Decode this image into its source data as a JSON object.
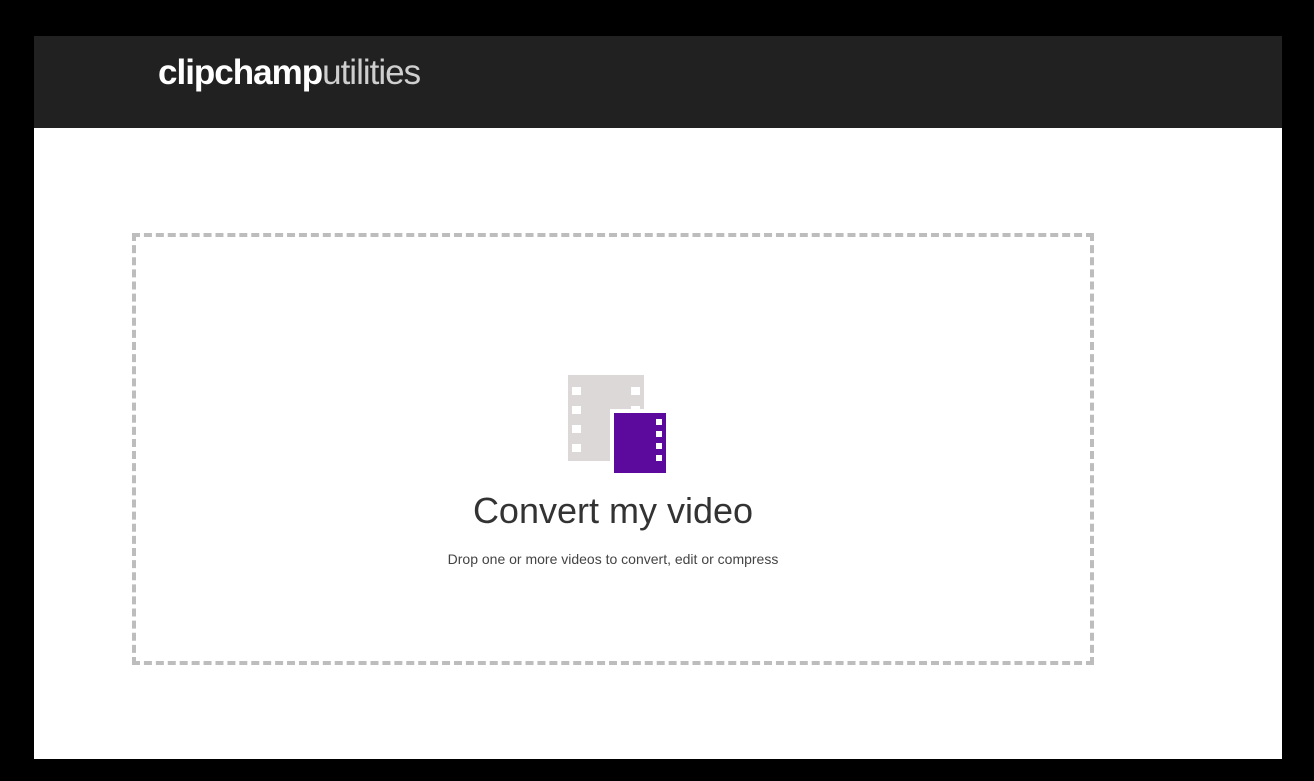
{
  "header": {
    "logo_bold": "clipchamp",
    "logo_light": "utilities"
  },
  "dropzone": {
    "icon": "film-icon",
    "title": "Convert my video",
    "subtitle": "Drop one or more videos to convert, edit or compress"
  },
  "colors": {
    "header_bg": "#212121",
    "accent": "#5c0a9e",
    "film_gray": "#dcd8d8",
    "dash_border": "#bdbdbd"
  }
}
